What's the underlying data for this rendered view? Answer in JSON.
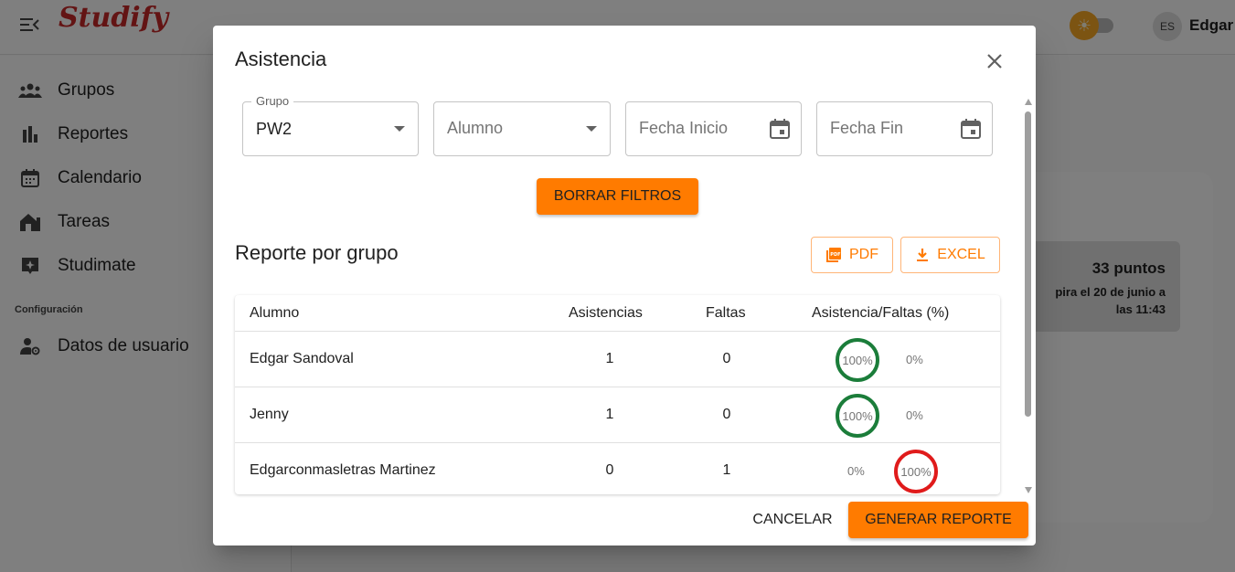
{
  "app": {
    "logo": "Studify",
    "lang": "ES",
    "username": "Edgar"
  },
  "sidebar": {
    "items": [
      {
        "label": "Grupos",
        "icon": "groups-icon"
      },
      {
        "label": "Reportes",
        "icon": "bar-chart-icon"
      },
      {
        "label": "Calendario",
        "icon": "calendar-icon"
      },
      {
        "label": "Tareas",
        "icon": "house-work-icon"
      },
      {
        "label": "Studimate",
        "icon": "sparkle-chat-icon"
      }
    ],
    "section": "Configuración",
    "config_items": [
      {
        "label": "Datos de usuario",
        "icon": "user-settings-icon"
      }
    ]
  },
  "background_card": {
    "points_title": "33 puntos",
    "points_sub_line1": "pira el 20 de junio a",
    "points_sub_line2": "las 11:43"
  },
  "dialog": {
    "title": "Asistencia",
    "filters": {
      "grupo_label": "Grupo",
      "grupo_value": "PW2",
      "alumno_placeholder": "Alumno",
      "fecha_inicio_placeholder": "Fecha Inicio",
      "fecha_fin_placeholder": "Fecha Fin"
    },
    "clear_button": "BORRAR FILTROS",
    "report_title": "Reporte por grupo",
    "pdf_button": "PDF",
    "excel_button": "EXCEL",
    "table": {
      "headers": [
        "Alumno",
        "Asistencias",
        "Faltas",
        "Asistencia/Faltas (%)"
      ],
      "rows": [
        {
          "alumno": "Edgar Sandoval",
          "asistencias": "1",
          "faltas": "0",
          "pct_asistencia": "100%",
          "pct_faltas": "0%",
          "highlight": "asistencia"
        },
        {
          "alumno": "Jenny",
          "asistencias": "1",
          "faltas": "0",
          "pct_asistencia": "100%",
          "pct_faltas": "0%",
          "highlight": "asistencia"
        },
        {
          "alumno": "Edgarconmasletras Martinez",
          "asistencias": "0",
          "faltas": "1",
          "pct_asistencia": "0%",
          "pct_faltas": "100%",
          "highlight": "faltas"
        }
      ]
    },
    "cancel_button": "CANCELAR",
    "generate_button": "GENERAR REPORTE"
  },
  "colors": {
    "accent": "#ff7b00",
    "ring_green": "#1b7d3a",
    "ring_red": "#e01b1b"
  }
}
